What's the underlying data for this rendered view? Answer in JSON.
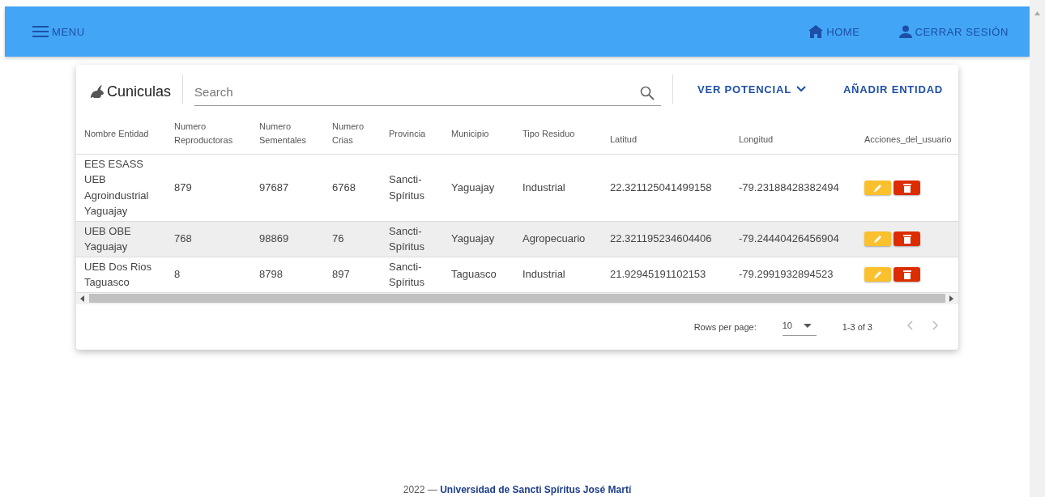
{
  "top_bar": {
    "menu": "MENU",
    "home": "HOME",
    "logout": "CERRAR SESIÓN"
  },
  "card": {
    "title": "Cuniculas",
    "search": {
      "placeholder": "Search"
    },
    "potential_button": "VER POTENCIAL",
    "add_button": "AÑADIR ENTIDAD"
  },
  "table": {
    "columns": [
      "Nombre Entidad",
      "Numero Reproductoras",
      "Numero Sementales",
      "Numero Crias",
      "Provincia",
      "Municipio",
      "Tipo Residuo",
      "Latitud",
      "Longitud",
      "Acciones_del_usuario"
    ],
    "rows": [
      {
        "selected": false,
        "cells": [
          "EES ESASS UEB Agroindustrial Yaguajay",
          "879",
          "97687",
          "6768",
          "Sancti-Spíritus",
          "Yaguajay",
          "Industrial",
          "22.321125041499158",
          "-79.23188428382494"
        ]
      },
      {
        "selected": true,
        "cells": [
          "UEB OBE Yaguajay",
          "768",
          "98869",
          "76",
          "Sancti-Spíritus",
          "Yaguajay",
          "Agropecuario",
          "22.321195234604406",
          "-79.24440426456904"
        ]
      },
      {
        "selected": false,
        "cells": [
          "UEB Dos Rios Taguasco",
          "8",
          "8798",
          "897",
          "Sancti-Spíritus",
          "Taguasco",
          "Industrial",
          "21.92945191102153",
          "-79.2991932894523"
        ]
      }
    ]
  },
  "pagination": {
    "rows_per_page_label": "Rows per page:",
    "rows_per_page": "10",
    "range": "1-3 of 3"
  },
  "footer": "2022 — **Universidad de Sancti Spíritus José Martí**"
}
